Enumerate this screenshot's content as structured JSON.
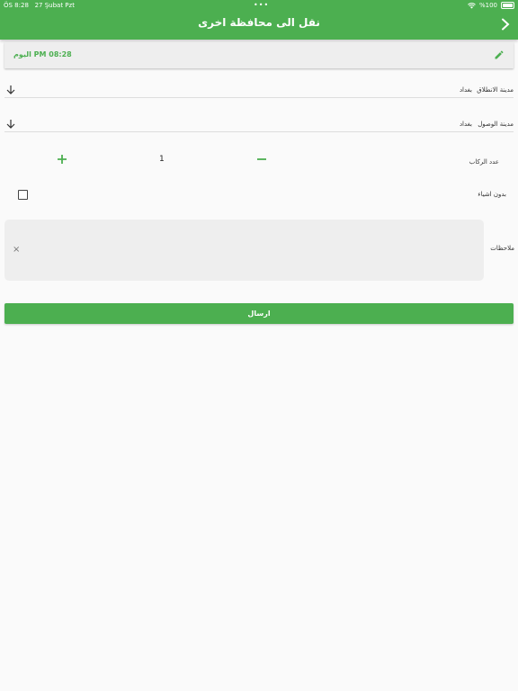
{
  "status_bar": {
    "time": "ÖS 8:28",
    "date": "27 Şubat Pzt",
    "dots": "•••",
    "battery": "%100"
  },
  "header": {
    "title": "نقل الى محافظة اخرى"
  },
  "date_card": {
    "value": "اليوم PM 08:28"
  },
  "form": {
    "departure_label": "مدينة الانطلاق",
    "departure_value": "بغداد",
    "arrival_label": "مدينة الوصول",
    "arrival_value": "بغداد",
    "passengers_label": "عدد الركاب",
    "passengers_count": "1",
    "no_items_label": "بدون اشياء",
    "notes_label": "ملاحظات",
    "notes_clear": "×",
    "submit_label": "ارسال"
  },
  "colors": {
    "primary": "#4caf50"
  }
}
